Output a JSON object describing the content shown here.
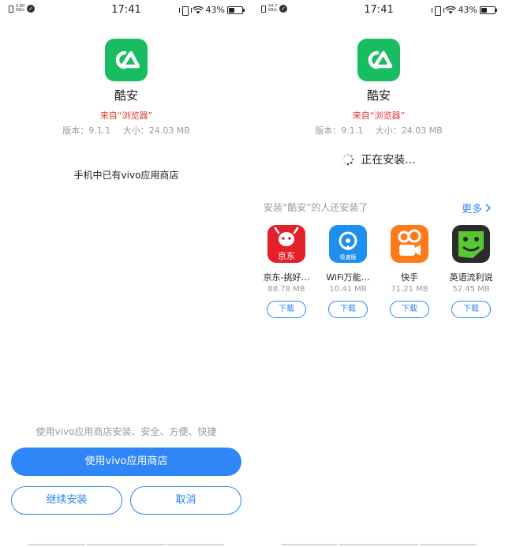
{
  "colors": {
    "accent": "#2f86f6",
    "brand_green": "#18bd62",
    "source_red": "#e8332b",
    "muted": "#9a9a9a"
  },
  "left": {
    "status": {
      "net_speed_value": "0.80",
      "net_speed_unit": "KB/s",
      "time": "17:41",
      "battery": "43%",
      "battery_level": 0.43
    },
    "app": {
      "name": "酷安",
      "source": "来自“浏览器”",
      "version": "版本：9.1.1",
      "size": "大小：24.03 MB"
    },
    "notice": "手机中已有vivo应用商店",
    "footer_hint": "使用vivo应用商店安装、安全、方便、快捷",
    "buttons": {
      "primary": "使用vivo应用商店",
      "continue": "继续安装",
      "cancel": "取消"
    }
  },
  "right": {
    "status": {
      "net_speed_value": "54.7",
      "net_speed_unit": "KB/s",
      "time": "17:41",
      "battery": "43%",
      "battery_level": 0.43
    },
    "app": {
      "name": "酷安",
      "source": "来自“浏览器”",
      "version": "版本：9.1.1",
      "size": "大小：24.03 MB"
    },
    "installing": "正在安装...",
    "recommend": {
      "title": "安装“酷安”的人还安装了",
      "more": "更多",
      "items": [
        {
          "name": "京东-挑好…",
          "size": "88.78 MB",
          "button": "下载",
          "icon_text": "京东",
          "icon": "jd-icon"
        },
        {
          "name": "WiFi万能…",
          "size": "10.41 MB",
          "button": "下载",
          "icon_text": "极速版",
          "icon": "wifi-key-icon"
        },
        {
          "name": "快手",
          "size": "71.21 MB",
          "button": "下载",
          "icon": "kuaishou-icon"
        },
        {
          "name": "英语流利说",
          "size": "52.45 MB",
          "button": "下载",
          "icon": "liulishuo-icon"
        }
      ]
    }
  }
}
